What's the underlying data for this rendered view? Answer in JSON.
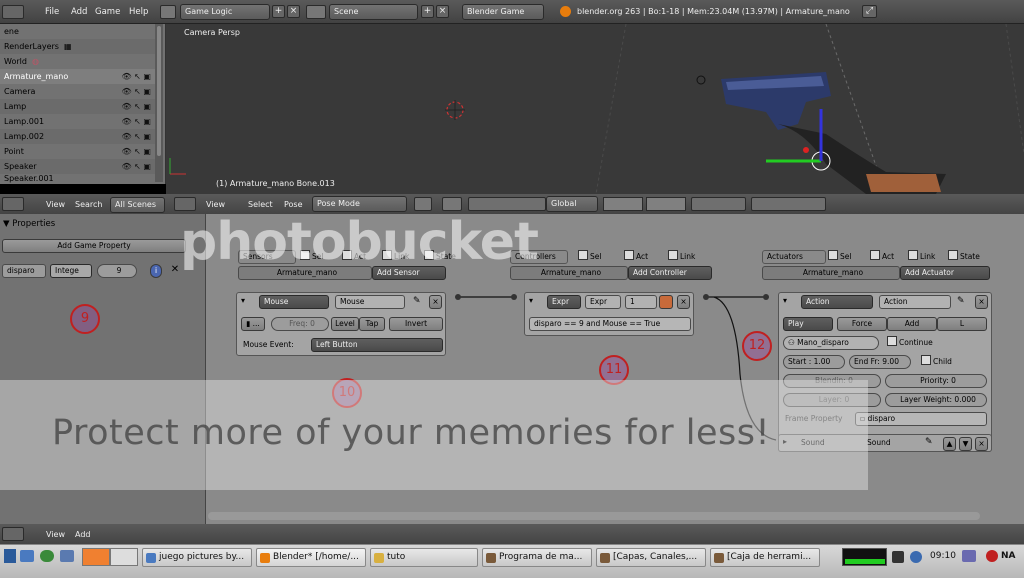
{
  "top_menu": {
    "file": "File",
    "add": "Add",
    "game": "Game",
    "help": "Help"
  },
  "top_combos": {
    "screen": "Game Logic",
    "scene": "Scene",
    "engine": "Blender Game"
  },
  "status_info": "blender.org 263 | Bo:1-18 | Mem:23.04M (13.97M) | Armature_mano",
  "outliner": {
    "items": [
      {
        "label": "ene"
      },
      {
        "label": "RenderLayers"
      },
      {
        "label": "World"
      },
      {
        "label": "Armature_mano"
      },
      {
        "label": "Camera"
      },
      {
        "label": "Lamp"
      },
      {
        "label": "Lamp.001"
      },
      {
        "label": "Lamp.002"
      },
      {
        "label": "Point"
      },
      {
        "label": "Speaker"
      },
      {
        "label": "Speaker.001"
      }
    ]
  },
  "viewport": {
    "label": "Camera Persp",
    "selection": "(1) Armature_mano Bone.013"
  },
  "v3d_header": {
    "view": "View",
    "select": "Select",
    "pose": "Pose",
    "mode": "Pose Mode",
    "orientation": "Global"
  },
  "left_header": {
    "view": "View",
    "search": "Search",
    "filter": "All Scenes"
  },
  "properties": {
    "title": "Properties",
    "add_prop": "Add Game Property",
    "prop_name": "disparo",
    "prop_type": "Intege",
    "prop_value": "9"
  },
  "logic": {
    "sensors": {
      "dropdown": "Sensors",
      "sel": "Sel",
      "act": "Act",
      "link": "Link",
      "state": "State",
      "object": "Armature_mano",
      "add": "Add Sensor",
      "type": "Mouse",
      "name": "Mouse",
      "freq": "Freq: 0",
      "level": "Level",
      "tap": "Tap",
      "invert": "Invert",
      "event_label": "Mouse Event:",
      "event_value": "Left Button"
    },
    "controllers": {
      "dropdown": "Controllers",
      "sel": "Sel",
      "act": "Act",
      "link": "Link",
      "object": "Armature_mano",
      "add": "Add Controller",
      "type": "Expr",
      "name": "Expr",
      "priority": "1",
      "expression": "disparo == 9 and Mouse == True"
    },
    "actuators": {
      "dropdown": "Actuators",
      "sel": "Sel",
      "act": "Act",
      "link": "Link",
      "state": "State",
      "object": "Armature_mano",
      "add": "Add Actuator",
      "type": "Action",
      "name": "Action",
      "play": "Play",
      "force": "Force",
      "add_mode": "Add",
      "l": "L",
      "action_name": "Mano_disparo",
      "continue": "Continue",
      "start": "Start : 1.00",
      "end": "End Fr: 9.00",
      "child": "Child",
      "blendin": "Blendin: 0",
      "priority": "Priority: 0",
      "layer": "Layer: 0",
      "layer_weight": "Layer Weight: 0.000",
      "frame_property_label": "Frame Property",
      "frame_property": "disparo",
      "sound_type": "Sound",
      "sound_name": "Sound"
    },
    "markers": [
      "9",
      "10",
      "11",
      "12"
    ]
  },
  "bottom_header": {
    "view": "View",
    "add": "Add"
  },
  "taskbar": {
    "tasks": [
      "juego pictures by...",
      "Blender* [/home/...",
      "tuto",
      "Programa de ma...",
      "[Capas, Canales,...",
      "[Caja de herrami..."
    ],
    "clock": "09:10",
    "lang": "NA"
  },
  "watermark": {
    "logo": "photobucket",
    "text": "Protect more of your memories for less!"
  }
}
